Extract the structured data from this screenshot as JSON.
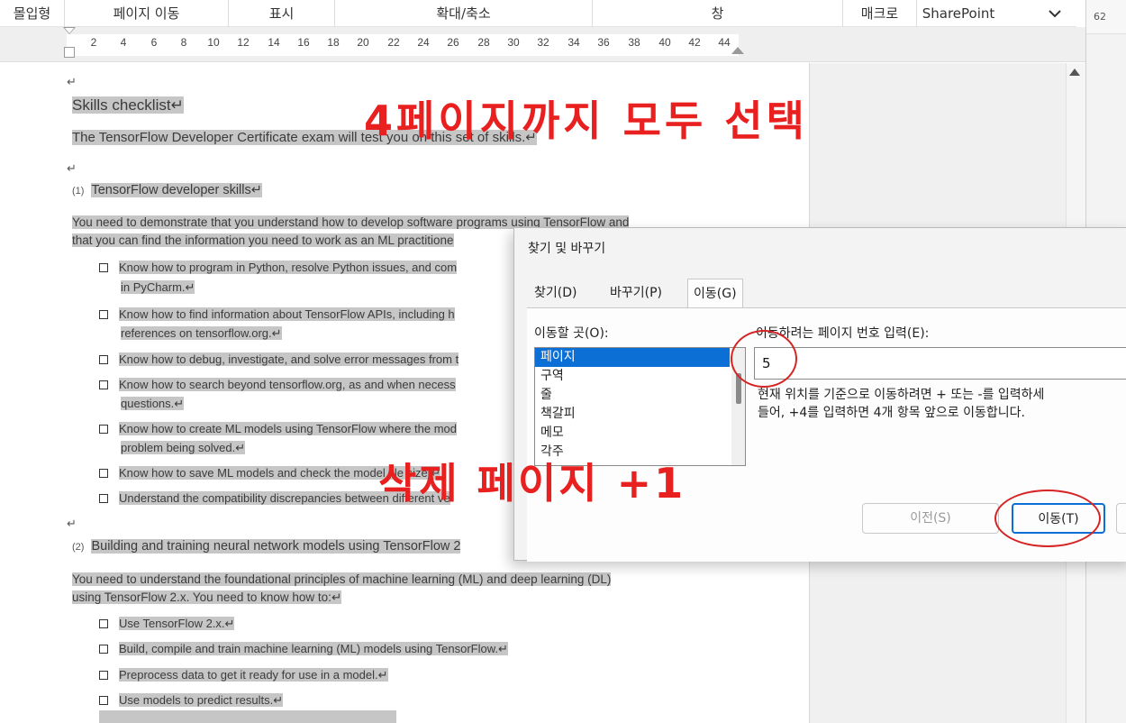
{
  "ribbon": {
    "groups": [
      "몰입형",
      "페이지 이동",
      "표시",
      "확대/축소",
      "창",
      "매크로",
      "SharePoint"
    ]
  },
  "right_window": {
    "number": "62"
  },
  "ruler": {
    "ticks": [
      "2",
      "4",
      "6",
      "8",
      "10",
      "12",
      "14",
      "16",
      "18",
      "20",
      "22",
      "24",
      "26",
      "28",
      "30",
      "32",
      "34",
      "36",
      "38",
      "40",
      "42",
      "44"
    ]
  },
  "document": {
    "title": "Skills checklist",
    "intro": "The TensorFlow Developer Certificate exam will test you on this set of skills.",
    "section1": {
      "number": "(1)",
      "heading": "TensorFlow developer skills",
      "para_line1": "You need to demonstrate that you understand how to develop software programs using TensorFlow and",
      "para_line2": "that you can find the information you need to work as an ML practitione",
      "bullets": [
        {
          "l1": "Know how to program in Python, resolve Python issues, and com",
          "l2": "in PyCharm."
        },
        {
          "l1": "Know how to find information about TensorFlow APIs, including h",
          "l2": "references on tensorflow.org."
        },
        {
          "l1": "Know how to debug, investigate, and solve error messages from t",
          "l2": ""
        },
        {
          "l1": "Know how to search beyond tensorflow.org, as and when necess",
          "l2": "questions."
        },
        {
          "l1": "Know how to create ML models using TensorFlow where the mod",
          "l2": "problem being solved."
        },
        {
          "l1": "Know how to save ML models and check the model file size.",
          "l2": ""
        },
        {
          "l1": "Understand the compatibility discrepancies between different ve",
          "l2": ""
        }
      ]
    },
    "section2": {
      "number": "(2)",
      "heading": "Building and training neural network models using TensorFlow 2",
      "para_line1": "You need to understand the foundational principles of machine learning (ML) and deep learning (DL)",
      "para_line2": "using TensorFlow 2.x. You need to know how to:",
      "bullets": [
        "Use TensorFlow 2.x.",
        "Build, compile and train machine learning (ML)  models using TensorFlow.",
        "Preprocess data to get it ready for use in a model.",
        "Use models to predict results."
      ]
    }
  },
  "annotations": {
    "top": "4페이지까지 모두 선택",
    "middle": "삭제 페이지 +1"
  },
  "dialog": {
    "title": "찾기 및 바꾸기",
    "tabs": [
      "찾기(D)",
      "바꾸기(P)",
      "이동(G)"
    ],
    "active_tab": "이동(G)",
    "goto_label": "이동할 곳(O):",
    "goto_items": [
      "페이지",
      "구역",
      "줄",
      "책갈피",
      "메모",
      "각주"
    ],
    "selected_item": "페이지",
    "page_label": "이동하려는 페이지 번호 입력(E):",
    "page_value": "5",
    "hint_line1": "현재 위치를 기준으로 이동하려면 + 또는 -를 입력하세",
    "hint_line2": "들어, +4를 입력하면 4개 항목 앞으로 이동합니다.",
    "prev_button": "이전(S)",
    "go_button": "이동(T)"
  }
}
